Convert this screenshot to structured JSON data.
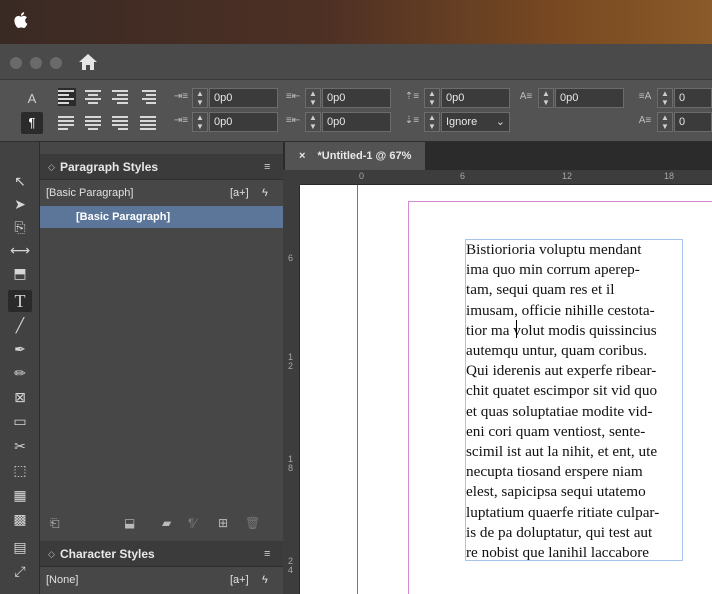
{
  "menubar": {
    "apple_icon": "apple-logo-icon"
  },
  "window": {
    "home_icon": "home-icon"
  },
  "control_panel": {
    "mode_char": "A",
    "mode_para": "¶",
    "fields": {
      "left_indent": "0p0",
      "right_indent": "0p0",
      "space_before": "0p0",
      "drop_cap_lines": "0p0",
      "baseline_shift": "0",
      "first_line_indent": "0p0",
      "last_line_indent": "0p0",
      "space_after": "0p0",
      "hyphen_option": "Ignore",
      "extra": "0"
    }
  },
  "panels": {
    "paragraph_styles": {
      "title": "Paragraph Styles",
      "header_item": "[Basic Paragraph]",
      "header_badge": "[a+]",
      "items": [
        "[Basic Paragraph]"
      ]
    },
    "character_styles": {
      "title": "Character Styles",
      "header_item": "[None]",
      "header_badge": "[a+]"
    }
  },
  "document": {
    "tab_close": "×",
    "tab_title": "*Untitled-1 @ 67%",
    "ruler_h": [
      "0",
      "6",
      "12",
      "18"
    ],
    "ruler_v": [
      "6",
      "1\n2",
      "1\n8",
      "2\n4"
    ],
    "text_lines": [
      "Bistiorioria voluptu mendant",
      "ima quo min corrum aperep-",
      "tam, sequi quam res et il",
      "imusam, officie nihille cestota-",
      "tior ma volut modis quissincius",
      "autemqu untur, quam coribus.",
      "Qui iderenis aut experfe ribear-",
      "chit quatet escimpor sit vid quo",
      "et quas soluptatiae modite vid-",
      "eni cori quam ventiost, sente-",
      "scimil ist aut la nihit, et ent, ute",
      "necupta tiosand erspere niam",
      "elest, sapicipsa sequi utatemo",
      "luptatium quaerfe ritiate culpar-",
      "is de pa doluptatur, qui test aut",
      "re nobist que lanihil laccabore"
    ]
  },
  "colors": {
    "selection": "#5b7699",
    "frame": "#a7c4ec",
    "margin": "#d58ad3"
  }
}
